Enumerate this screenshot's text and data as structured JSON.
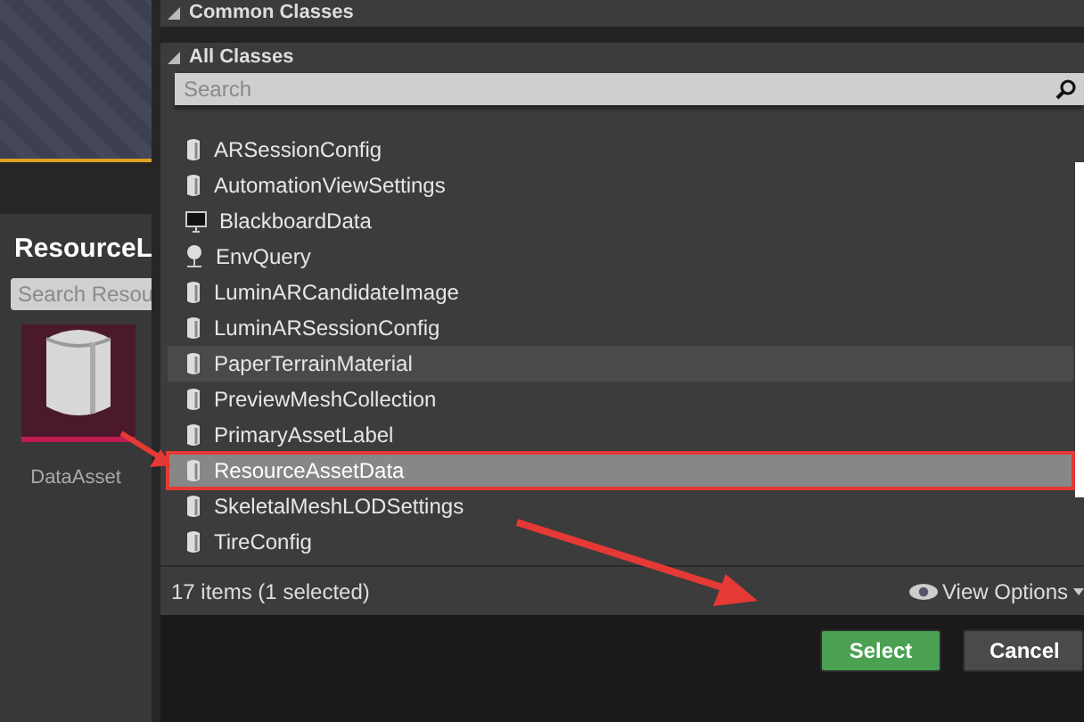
{
  "left_panel": {
    "title": "ResourceL",
    "search": {
      "placeholder": "Search Resou"
    },
    "asset": {
      "label": "DataAsset"
    }
  },
  "dialog": {
    "sections": [
      {
        "label": "Common Classes",
        "expanded": true
      },
      {
        "label": "All Classes",
        "expanded": true
      }
    ],
    "search": {
      "placeholder": "Search"
    },
    "classes": [
      {
        "name": "ARSessionConfig",
        "kind": "class",
        "selected": false,
        "hovered": false
      },
      {
        "name": "AutomationViewSettings",
        "kind": "class",
        "selected": false,
        "hovered": false
      },
      {
        "name": "BlackboardData",
        "kind": "monitor",
        "selected": false,
        "hovered": false
      },
      {
        "name": "EnvQuery",
        "kind": "pin",
        "selected": false,
        "hovered": false
      },
      {
        "name": "LuminARCandidateImage",
        "kind": "class",
        "selected": false,
        "hovered": false
      },
      {
        "name": "LuminARSessionConfig",
        "kind": "class",
        "selected": false,
        "hovered": false
      },
      {
        "name": "PaperTerrainMaterial",
        "kind": "class",
        "selected": false,
        "hovered": true
      },
      {
        "name": "PreviewMeshCollection",
        "kind": "class",
        "selected": false,
        "hovered": false
      },
      {
        "name": "PrimaryAssetLabel",
        "kind": "class",
        "selected": false,
        "hovered": false
      },
      {
        "name": "ResourceAssetData",
        "kind": "class",
        "selected": true,
        "hovered": false
      },
      {
        "name": "SkeletalMeshLODSettings",
        "kind": "class",
        "selected": false,
        "hovered": false
      },
      {
        "name": "TireConfig",
        "kind": "class",
        "selected": false,
        "hovered": false
      }
    ],
    "status": "17 items (1 selected)",
    "view_options": "View Options",
    "buttons": [
      {
        "label": "Select",
        "kind": "primary"
      },
      {
        "label": "Cancel",
        "kind": "secondary"
      }
    ]
  }
}
